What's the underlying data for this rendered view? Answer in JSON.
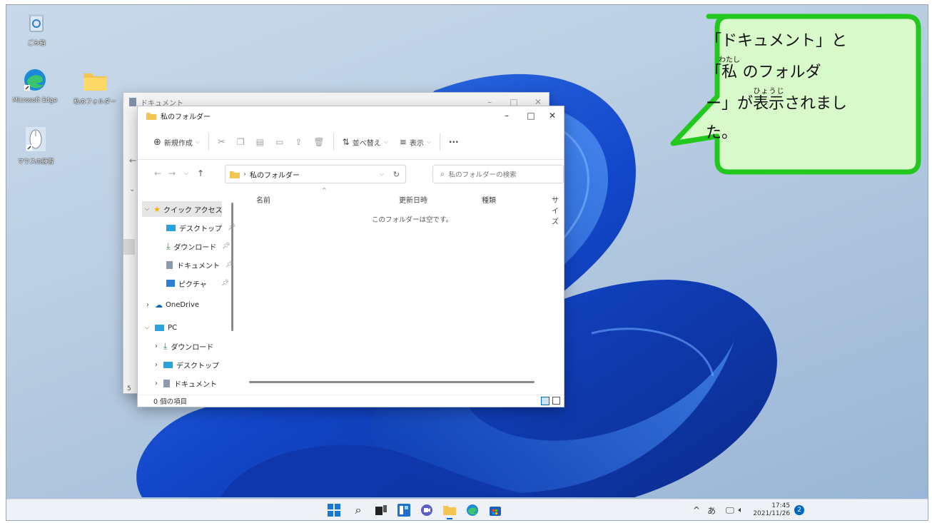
{
  "desktop": {
    "icons": [
      {
        "label": "ごみ箱",
        "icon": "recycle-bin-icon"
      },
      {
        "label": "Microsoft Edge",
        "icon": "edge-icon"
      },
      {
        "label": "私のフォルダー",
        "icon": "folder-icon"
      },
      {
        "label": "マウスの練習",
        "icon": "mouse-icon"
      }
    ]
  },
  "back_window": {
    "title": "ドキュメント",
    "side_partial": "5"
  },
  "front_window": {
    "title": "私のフォルダー",
    "toolbar": {
      "new": "新規作成",
      "sort": "並べ替え",
      "view": "表示",
      "more": "···"
    },
    "address": "私のフォルダー",
    "search_placeholder": "私のフォルダーの検索",
    "sidebar": {
      "quick_access": "クイック アクセス",
      "desktop": "デスクトップ",
      "downloads": "ダウンロード",
      "documents": "ドキュメント",
      "pictures": "ピクチャ",
      "onedrive": "OneDrive",
      "pc": "PC",
      "pc_downloads": "ダウンロード",
      "pc_desktop": "デスクトップ",
      "pc_documents": "ドキュメント"
    },
    "columns": {
      "name": "名前",
      "date": "更新日時",
      "type": "種類",
      "size": "サイズ"
    },
    "empty_message": "このフォルダーは空です。",
    "status": "0 個の項目"
  },
  "callout": {
    "q1": "「ドキュメント」と",
    "q2_open": "「",
    "q2_kanji": "私",
    "q2_kanji_ruby": "わたし",
    "q2_rest": "のフォルダ",
    "q3_dash": "ー」が",
    "q3_kanji": "表示",
    "q3_kanji_ruby": "ひょうじ",
    "q3_rest": "されまし",
    "q4": "た。"
  },
  "taskbar": {
    "tray_ime": "あ",
    "time": "17:45",
    "date": "2021/11/26",
    "notifications": "2"
  },
  "colors": {
    "callout_fill": "#d8f9c9",
    "callout_border": "#22c81e",
    "accent": "#0067c0"
  }
}
